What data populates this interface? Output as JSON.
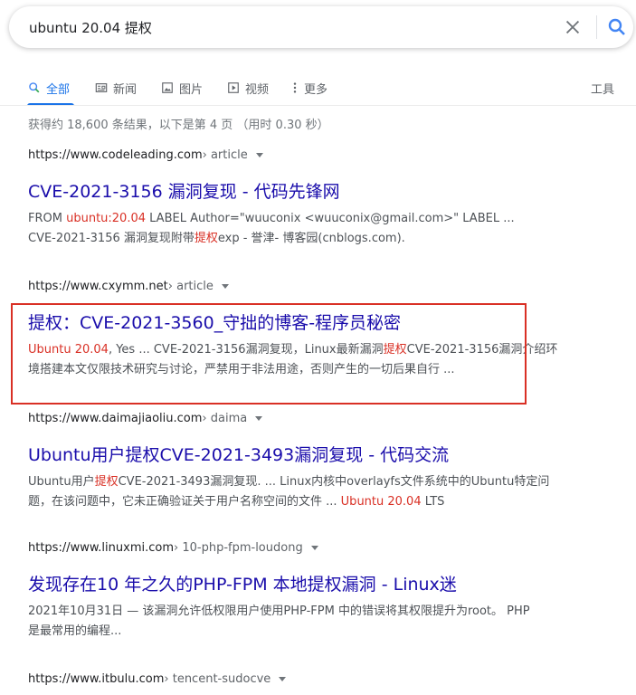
{
  "search": {
    "query": "ubuntu 20.04 提权"
  },
  "tabs": [
    {
      "label": "全部",
      "icon": "search-icon"
    },
    {
      "label": "新闻",
      "icon": "news-icon"
    },
    {
      "label": "图片",
      "icon": "image-icon"
    },
    {
      "label": "视频",
      "icon": "video-icon"
    },
    {
      "label": "更多",
      "icon": "more-icon"
    }
  ],
  "tools_label": "工具",
  "stats": "获得约 18,600 条结果，以下是第 4 页  （用时 0.30 秒）",
  "results": [
    {
      "cite_domain": "https://www.codeleading.com",
      "cite_path": " › article",
      "title": "CVE-2021-3156 漏洞复现 - 代码先锋网",
      "s1a": "FROM ",
      "s1b": "ubuntu:20.04",
      "s1c": " LABEL Author=\"wuuconix <wuuconix@gmail.com>\" LABEL ...",
      "s2a": "CVE-2021-3156 漏洞复现附带",
      "s2b": "提权",
      "s2c": "exp - 誉津- 博客园(cnblogs.com)."
    },
    {
      "cite_domain": "https://www.cxymm.net",
      "cite_path": " › article",
      "title": "提权：CVE-2021-3560_守拙的博客-程序员秘密",
      "s1a": "",
      "s1b": "Ubuntu 20.04",
      "s1c": ", Yes ... CVE-2021-3156漏洞复现，Linux最新漏洞",
      "s1d": "提权",
      "s1e": "CVE-2021-3156漏洞介绍环",
      "s2a": "境搭建本文仅限技术研究与讨论，严禁用于非法用途，否则产生的一切后果自行 ..."
    },
    {
      "cite_domain": "https://www.daimajiaoliu.com",
      "cite_path": " › daima",
      "title": "Ubuntu用户提权CVE-2021-3493漏洞复现 - 代码交流",
      "s1a": "Ubuntu用户",
      "s1b": "提权",
      "s1c": "CVE-2021-3493漏洞复现. ... Linux内核中overlayfs文件系统中的Ubuntu特定问",
      "s2a": "题，在该问题中，它未正确验证关于用户名称空间的文件 ... ",
      "s2b": "Ubuntu 20.04",
      "s2c": " LTS"
    },
    {
      "cite_domain": "https://www.linuxmi.com",
      "cite_path": " › 10-php-fpm-loudong",
      "title": "发现存在10 年之久的PHP-FPM 本地提权漏洞 - Linux迷",
      "s1a": "2021年10月31日 — 该漏洞允许低权限用户使用PHP-FPM 中的错误将其权限提升为root。 PHP",
      "s2a": "是最常用的编程..."
    },
    {
      "cite_domain": "https://www.itbulu.com",
      "cite_path": " › tencent-sudocve"
    }
  ]
}
